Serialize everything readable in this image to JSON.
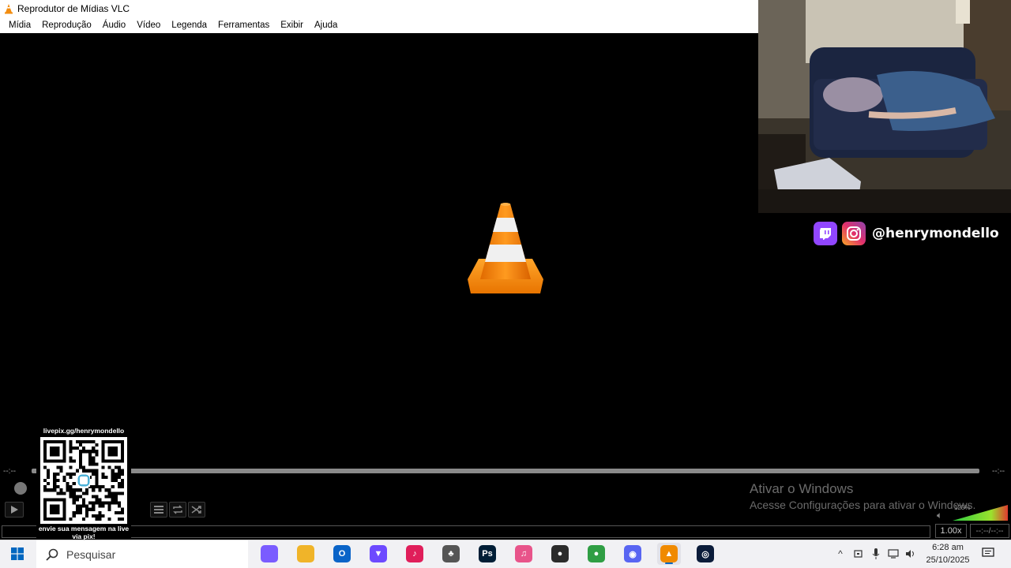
{
  "window": {
    "title": "Reprodutor de Mídias VLC"
  },
  "menu": [
    "Mídia",
    "Reprodução",
    "Áudio",
    "Vídeo",
    "Legenda",
    "Ferramentas",
    "Exibir",
    "Ajuda"
  ],
  "player": {
    "elapsed": "--:--",
    "total": "--:--",
    "speed": "1.00x",
    "time_display": "--:--/--:--",
    "volume_label": "125%",
    "volume_level": 1.25
  },
  "overlay": {
    "social_handle": "@henrymondello",
    "qr_url": "livepix.gg/henrymondello",
    "qr_caption": "envie sua mensagem na live via pix!"
  },
  "watermark": {
    "line1": "Ativar o Windows",
    "line2": "Acesse Configurações para ativar o Windows."
  },
  "taskbar": {
    "search_placeholder": "Pesquisar",
    "apps": [
      {
        "name": "copilot-icon",
        "color": "#7a5cff",
        "glyph": ""
      },
      {
        "name": "file-explorer-icon",
        "color": "#f0b429",
        "glyph": ""
      },
      {
        "name": "outlook-icon",
        "color": "#0a64c8",
        "glyph": "O"
      },
      {
        "name": "proton-vpn-icon",
        "color": "#6d4aff",
        "glyph": "▼"
      },
      {
        "name": "tiktok-icon",
        "color": "#e01e5a",
        "glyph": "♪"
      },
      {
        "name": "audio-app-icon",
        "color": "#555",
        "glyph": "♣"
      },
      {
        "name": "photoshop-icon",
        "color": "#001e36",
        "glyph": "Ps"
      },
      {
        "name": "itunes-icon",
        "color": "#e8548a",
        "glyph": "♫"
      },
      {
        "name": "obs-icon",
        "color": "#2b2b2b",
        "glyph": "●"
      },
      {
        "name": "chrome-icon",
        "color": "#2f9e44",
        "glyph": "●"
      },
      {
        "name": "discord-icon",
        "color": "#5865f2",
        "glyph": "◉"
      },
      {
        "name": "vlc-icon",
        "color": "#f08a00",
        "glyph": "▲"
      },
      {
        "name": "webcam-app-icon",
        "color": "#0b1c3a",
        "glyph": "◎"
      }
    ],
    "time": "6:28 am",
    "date": "25/10/2025"
  },
  "colors": {
    "vlc_orange": "#f28c0f",
    "twitch": "#9146ff",
    "instagram": "#e1306c"
  }
}
